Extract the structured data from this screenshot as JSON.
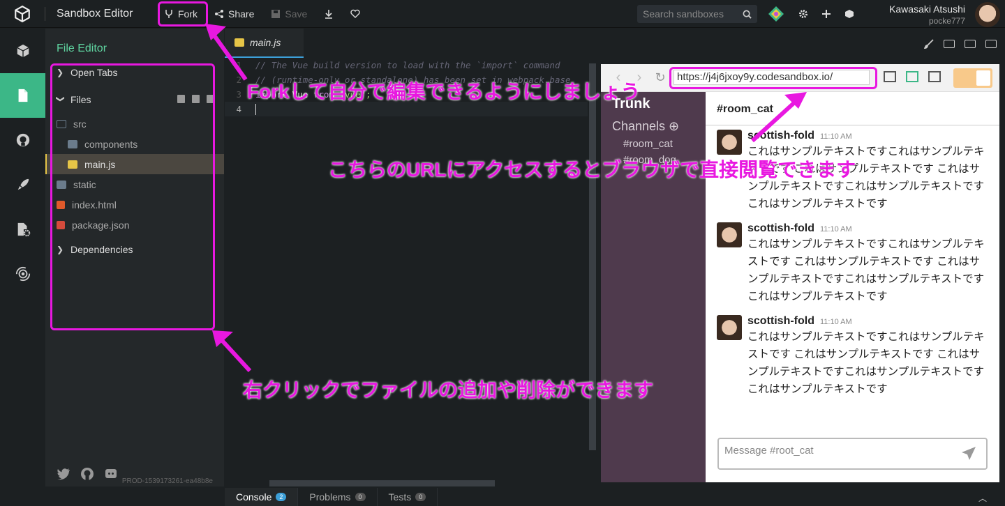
{
  "topbar": {
    "title": "Sandbox Editor",
    "fork": "Fork",
    "share": "Share",
    "save": "Save",
    "search_placeholder": "Search sandboxes",
    "user_name": "Kawasaki Atsushi",
    "user_handle": "pocke777"
  },
  "sidebar": {
    "title": "File Editor",
    "open_tabs": "Open Tabs",
    "files": "Files",
    "tree": [
      {
        "name": "src",
        "type": "folder-open"
      },
      {
        "name": "components",
        "type": "folder"
      },
      {
        "name": "main.js",
        "type": "js"
      },
      {
        "name": "static",
        "type": "folder"
      },
      {
        "name": "index.html",
        "type": "html"
      },
      {
        "name": "package.json",
        "type": "json"
      }
    ],
    "dependencies": "Dependencies",
    "build": "PROD-1539173261-ea48b8e"
  },
  "editor": {
    "tab": "main.js",
    "lines": [
      {
        "n": "1",
        "text": "// The Vue build version to load with the `import` command"
      },
      {
        "n": "2",
        "text": "// (runtime-only or standalone) has been set in webpack.base"
      },
      {
        "n": "3",
        "kw1": "import",
        "id": " Vue ",
        "kw2": "from",
        "str": " \"vue\";"
      },
      {
        "n": "4"
      }
    ]
  },
  "browser": {
    "url": "https://j4j6jxoy9y.codesandbox.io/"
  },
  "slack": {
    "team": "Trunk",
    "channels_label": "Channels ⊕",
    "channels": [
      "#room_cat",
      "#room_dog"
    ],
    "current_channel": "#room_cat",
    "messages": [
      {
        "user": "scottish-fold",
        "time": "11:10 AM",
        "text": "これはサンプルテキストですこれはサンプルテキストです これはサンプルテキストです これはサンプルテキストですこれはサンプルテキストですこれはサンプルテキストです"
      },
      {
        "user": "scottish-fold",
        "time": "11:10 AM",
        "text": "これはサンプルテキストですこれはサンプルテキストです これはサンプルテキストです これはサンプルテキストですこれはサンプルテキストですこれはサンプルテキストです"
      },
      {
        "user": "scottish-fold",
        "time": "11:10 AM",
        "text": "これはサンプルテキストですこれはサンプルテキストです これはサンプルテキストです これはサンプルテキストですこれはサンプルテキストですこれはサンプルテキストです"
      }
    ],
    "message_placeholder": "Message #root_cat"
  },
  "bottom": {
    "tabs": [
      {
        "label": "Console",
        "count": "2"
      },
      {
        "label": "Problems",
        "count": "0"
      },
      {
        "label": "Tests",
        "count": "0"
      }
    ]
  },
  "annotations": {
    "fork": "Forkして自分で編集できるようにしましょう",
    "url": "こちらのURLにアクセスするとブラウザで直接閲覧できます",
    "files": "右クリックでファイルの追加や削除ができます"
  },
  "colors": {
    "annotation": "#e818e0",
    "accent": "#3cb787"
  }
}
